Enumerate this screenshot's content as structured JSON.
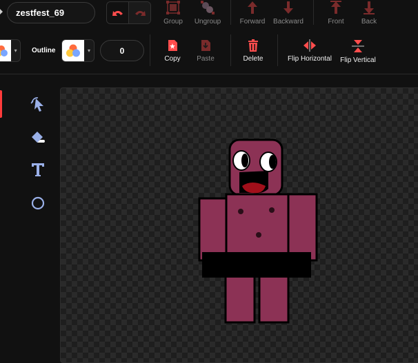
{
  "header": {
    "costume_name": "zestfest_69"
  },
  "toolbar": {
    "group_label": "Group",
    "ungroup_label": "Ungroup",
    "forward_label": "Forward",
    "backward_label": "Backward",
    "front_label": "Front",
    "back_label": "Back",
    "copy_label": "Copy",
    "paste_label": "Paste",
    "delete_label": "Delete",
    "flip_horizontal_label": "Flip Horizontal",
    "flip_vertical_label": "Flip Vertical"
  },
  "fill_outline": {
    "outline_label": "Outline",
    "outline_width": "0"
  },
  "side_tools": [
    {
      "name": "select",
      "icon": "reshape-select-icon"
    },
    {
      "name": "eraser",
      "icon": "eraser-icon"
    },
    {
      "name": "text",
      "icon": "text-icon"
    },
    {
      "name": "circle",
      "icon": "circle-icon"
    }
  ],
  "colors": {
    "accent": "#ff3b3b",
    "toolbar_icon_active": "#ff4d4d",
    "toolbar_icon_dim": "#7a2b2b",
    "tool_icon": "#9ab0e8",
    "character_body": "#8c3255",
    "canvas_check_dark": "#1e1e1e",
    "canvas_check_light": "#2a2a2a"
  }
}
